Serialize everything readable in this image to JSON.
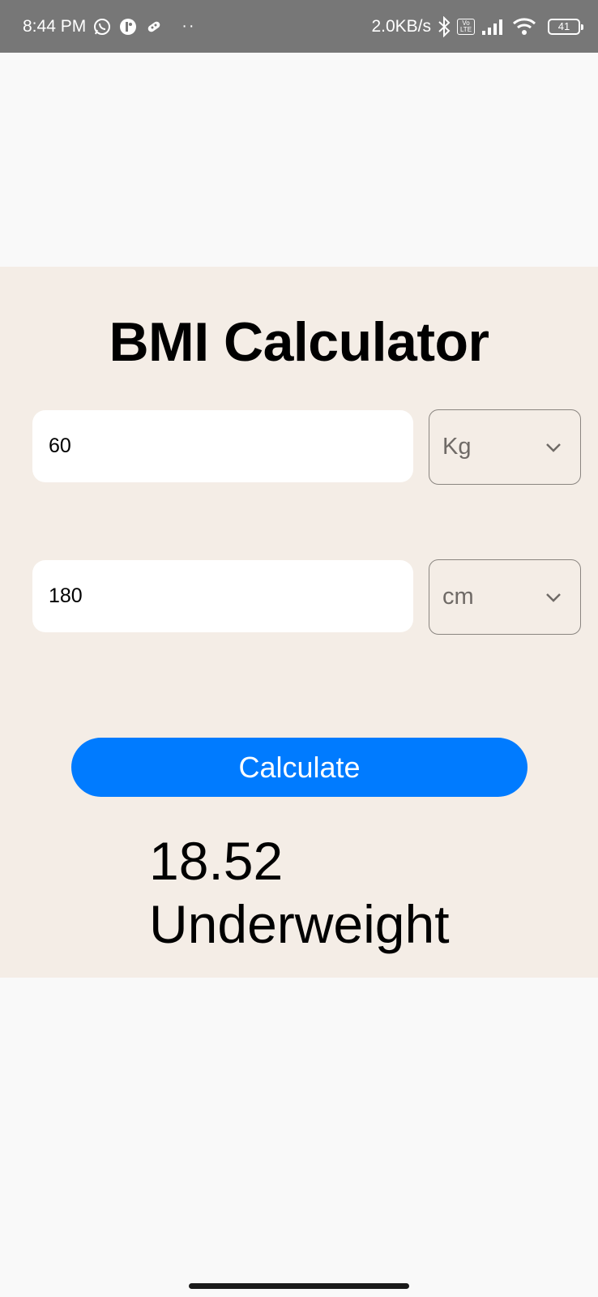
{
  "status_bar": {
    "time": "8:44 PM",
    "net_speed": "2.0KB/s",
    "volte_label": "Vo LTE",
    "battery": "41",
    "icons": [
      "whatsapp-icon",
      "app-icon",
      "gamepad-icon",
      "bluetooth-icon",
      "signal-icon",
      "wifi-icon",
      "battery-icon"
    ],
    "dots": "··"
  },
  "app": {
    "title": "BMI Calculator",
    "weight": {
      "value": "60",
      "unit": "Kg"
    },
    "height": {
      "value": "180",
      "unit": "cm"
    },
    "calculate_label": "Calculate",
    "result": {
      "value": "18.52",
      "status": "Underweight"
    }
  },
  "colors": {
    "card_bg": "#f4ede6",
    "button": "#007bff",
    "status_bar": "#777777"
  }
}
